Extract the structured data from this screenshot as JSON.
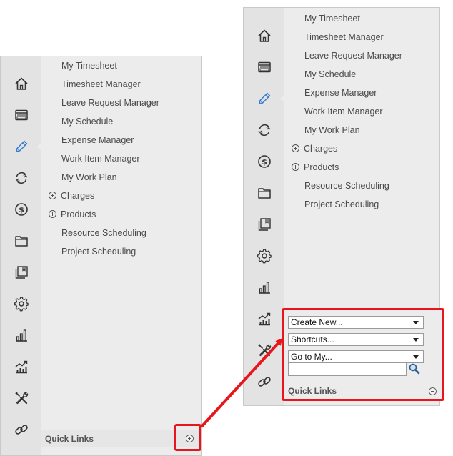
{
  "menu_items": [
    {
      "label": "My Timesheet",
      "expandable": false
    },
    {
      "label": "Timesheet Manager",
      "expandable": false
    },
    {
      "label": "Leave Request Manager",
      "expandable": false
    },
    {
      "label": "My Schedule",
      "expandable": false
    },
    {
      "label": "Expense Manager",
      "expandable": false
    },
    {
      "label": "Work Item Manager",
      "expandable": false
    },
    {
      "label": "My Work Plan",
      "expandable": false
    },
    {
      "label": "Charges",
      "expandable": true
    },
    {
      "label": "Products",
      "expandable": true
    },
    {
      "label": "Resource Scheduling",
      "expandable": false
    },
    {
      "label": "Project Scheduling",
      "expandable": false
    }
  ],
  "rail_icons": [
    "home-icon",
    "window-icon",
    "pencil-icon",
    "sync-icon",
    "dollar-icon",
    "folder-icon",
    "pages-icon",
    "gear-icon",
    "bar-chart-icon",
    "trend-chart-icon",
    "tools-icon",
    "link-icon"
  ],
  "active_rail_icon": "pencil-icon",
  "left_panel": {
    "quick_links_label": "Quick Links",
    "toggle_icon": "expand-plus-icon"
  },
  "right_panel": {
    "quick_links_label": "Quick Links",
    "toggle_icon": "collapse-minus-icon",
    "create_new": "Create New...",
    "shortcuts": "Shortcuts...",
    "go_to_my": "Go to My...",
    "search_value": ""
  },
  "colors": {
    "highlight": "#e8161c",
    "icon_blue": "#3a7bd5",
    "icon_dark": "#333333",
    "panel_bg": "#ececec",
    "rail_bg": "#e3e3e3"
  }
}
